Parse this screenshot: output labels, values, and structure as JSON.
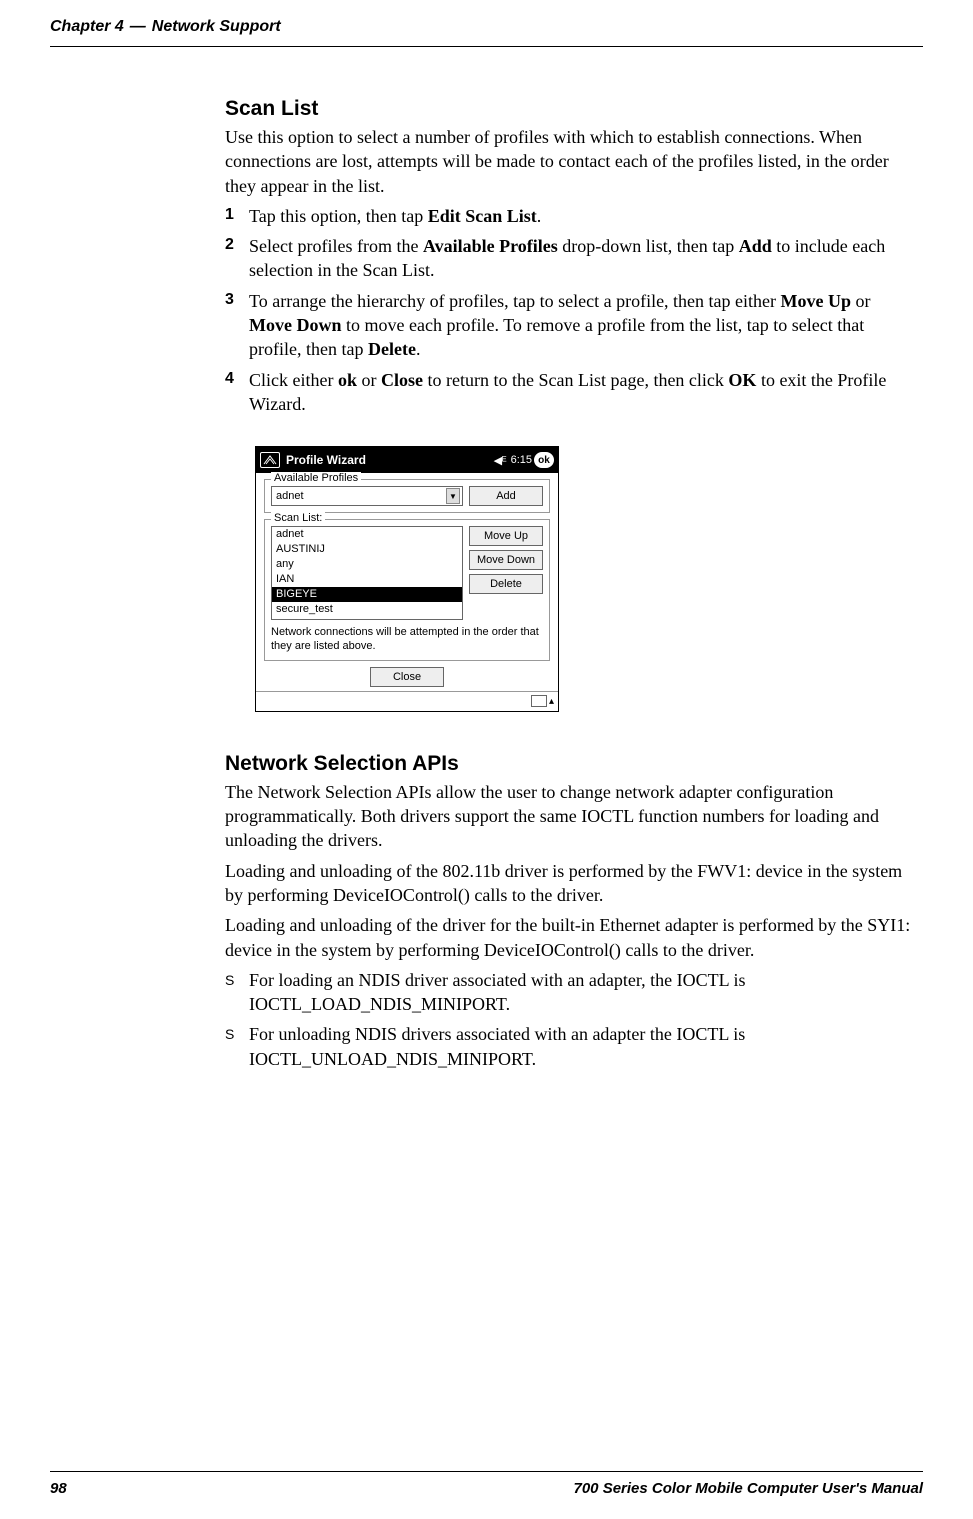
{
  "header": {
    "chapter": "Chapter 4",
    "dash": "—",
    "title_part": "Network Support"
  },
  "sec1": {
    "title": "Scan List",
    "intro": "Use this option to select a number of profiles with which to establish connections. When connections are lost, attempts will be made to contact each of the profiles listed, in the order they appear in the list.",
    "step1_a": "Tap this option, then tap ",
    "step1_b": "Edit Scan List",
    "step1_c": ".",
    "step2_a": "Select profiles from the ",
    "step2_b": "Available Profiles",
    "step2_c": " drop-down list, then tap ",
    "step2_d": "Add",
    "step2_e": " to include each selection in the Scan List.",
    "step3_a": "To arrange the hierarchy of profiles, tap to select a profile, then tap either ",
    "step3_b": "Move Up",
    "step3_c": " or ",
    "step3_d": "Move Down",
    "step3_e": " to move each profile. To remove a profile from the list, tap to select that profile, then tap ",
    "step3_f": "Delete",
    "step3_g": ".",
    "step4_a": "Click either ",
    "step4_b": "ok",
    "step4_c": " or ",
    "step4_d": "Close",
    "step4_e": " to return to the Scan List page, then click ",
    "step4_f": "OK",
    "step4_g": " to exit the Profile Wizard."
  },
  "wizard": {
    "title": "Profile Wizard",
    "speaker_glyph": "◀ᴱ",
    "time": "6:15",
    "ok": "ok",
    "legend1": "Available Profiles",
    "combo_value": "adnet",
    "btn_add": "Add",
    "legend2": "Scan List:",
    "items": [
      "adnet",
      "AUSTINIJ",
      "any",
      "IAN",
      "BIGEYE",
      "secure_test"
    ],
    "selected_index": 4,
    "btn_up": "Move Up",
    "btn_down": "Move Down",
    "btn_del": "Delete",
    "note": "Network connections will be attempted in the order that they are listed above.",
    "btn_close": "Close",
    "kbd_caret": "▴"
  },
  "sec2": {
    "title": "Network Selection APIs",
    "p1": "The Network Selection APIs allow the user to change network adapter configuration programmatically. Both drivers support the same IOCTL function numbers for loading and unloading the drivers.",
    "p2": "Loading and unloading of the 802.11b driver is performed by the FWV1: device in the system by performing DeviceIOControl() calls to the driver.",
    "p3": "Loading and unloading of the driver for the built-in Ethernet adapter is performed by the SYI1: device in the system by performing DeviceIOControl() calls to the driver.",
    "b1": "For loading an NDIS driver associated with an adapter, the IOCTL is IOCTL_LOAD_NDIS_MINIPORT.",
    "b2": "For unloading NDIS drivers associated with an adapter the IOCTL is IOCTL_UNLOAD_NDIS_MINIPORT."
  },
  "footer": {
    "page": "98",
    "book": "700 Series Color Mobile Computer User's Manual"
  },
  "nums": {
    "n1": "1",
    "n2": "2",
    "n3": "3",
    "n4": "4"
  },
  "bullet": "S"
}
